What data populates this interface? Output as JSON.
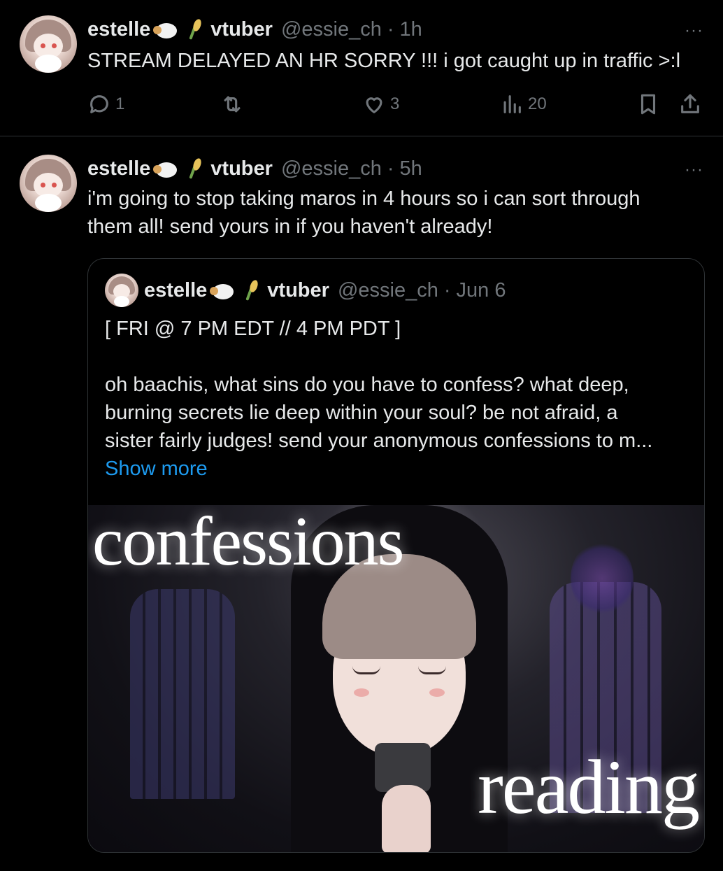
{
  "tweets": [
    {
      "author": "estelle",
      "badge_word": "vtuber",
      "handle": "@essie_ch",
      "sep": "·",
      "time": "1h",
      "more": "···",
      "text": "STREAM DELAYED AN HR SORRY !!! i got caught up in traffic >:l",
      "stats": {
        "replies": "1",
        "likes": "3",
        "views": "20"
      }
    },
    {
      "author": "estelle",
      "badge_word": "vtuber",
      "handle": "@essie_ch",
      "sep": "·",
      "time": "5h",
      "more": "···",
      "text_lines": [
        "i'm going to stop taking maros in 4 hours so i can sort through",
        "them all! send yours in if you haven't already!"
      ],
      "quote": {
        "author": "estelle",
        "badge_word": "vtuber",
        "handle": "@essie_ch",
        "sep": "·",
        "date": "Jun 6",
        "lines": [
          "[ FRI @ 7 PM EDT // 4 PM PDT ]",
          "",
          "oh baachis, what sins do you have to confess? what deep,",
          "burning secrets lie deep within your soul? be not afraid, a",
          "sister fairly judges! send your anonymous confessions to m..."
        ],
        "show_more": "Show more",
        "image_text": {
          "top": "confessions",
          "bottom": "reading"
        }
      }
    }
  ],
  "icons": {
    "reply": "reply-icon",
    "retweet": "retweet-icon",
    "like": "heart-icon",
    "views": "views-icon",
    "bookmark": "bookmark-icon",
    "share": "share-icon",
    "more": "more-icon",
    "emoji_1": "sheep-emoji",
    "emoji_2": "rice-emoji"
  },
  "colors": {
    "background": "#000000",
    "text": "#e7e9ea",
    "muted": "#71767b",
    "link": "#1d9bf0",
    "border": "#2f3336"
  }
}
